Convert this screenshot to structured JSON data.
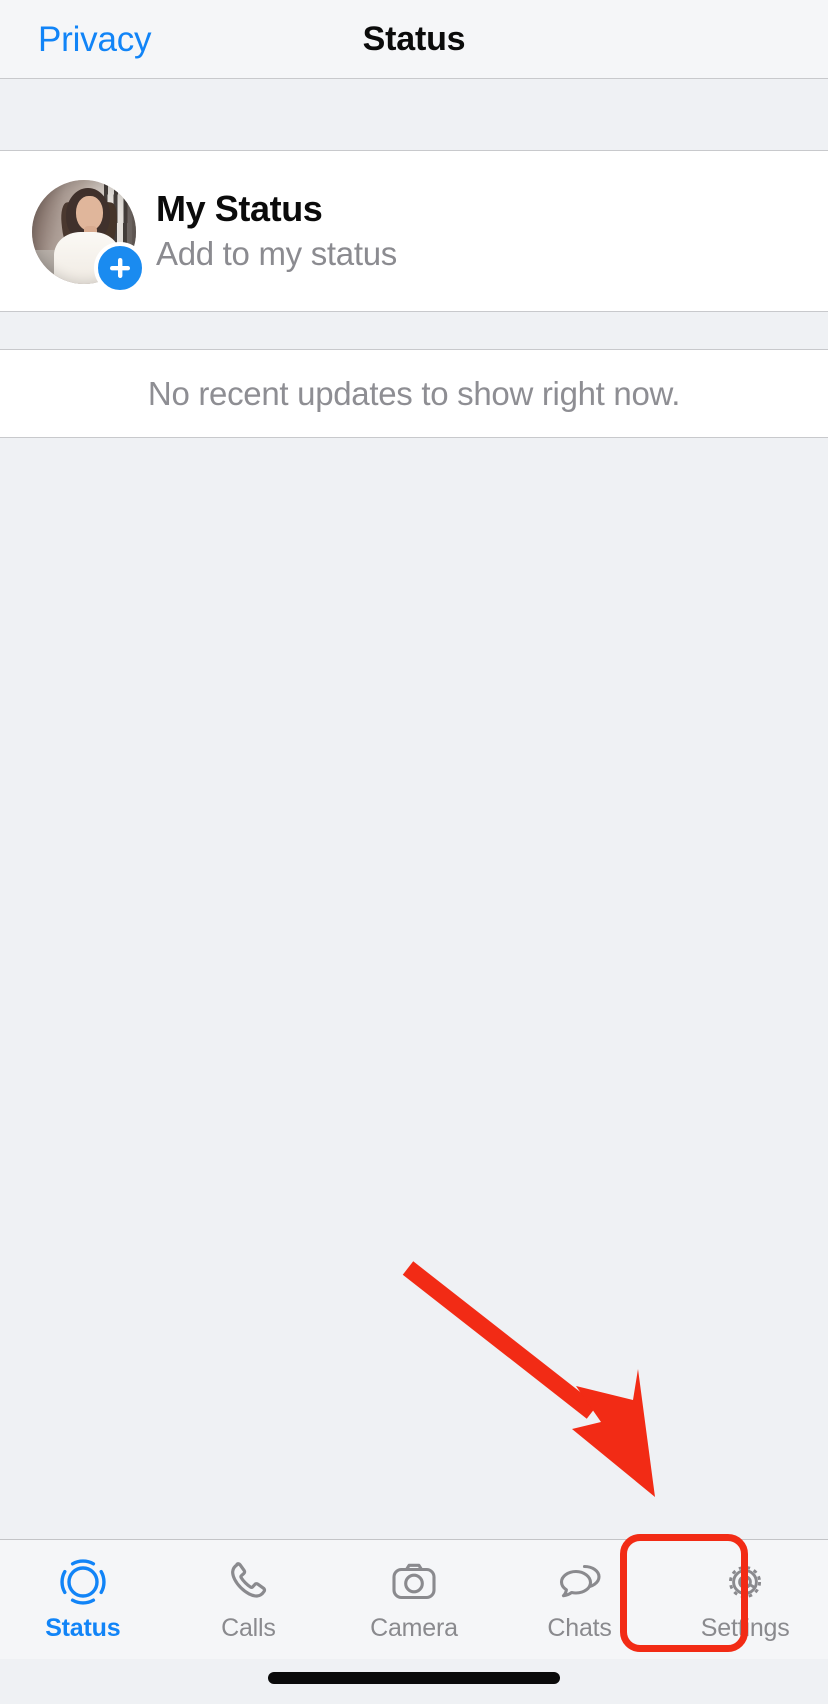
{
  "navbar": {
    "back_label": "Privacy",
    "title": "Status",
    "accent_color": "#1184f7"
  },
  "my_status": {
    "title": "My Status",
    "subtitle": "Add to my status",
    "avatar_name": "profile-photo",
    "add_badge_icon": "plus-icon",
    "camera_button_icon": "camera-icon",
    "edit_button_icon": "pencil-icon",
    "button_bg_color": "#e7e9f8",
    "icon_color": "#1a7df0"
  },
  "empty_state": {
    "message": "No recent updates to show right now."
  },
  "annotation": {
    "arrow_color": "#f22b15",
    "highlight_color": "#f22b15",
    "highlight_target": "Settings"
  },
  "tabbar": {
    "items": [
      {
        "label": "Status",
        "icon": "status-rings-icon",
        "active": true
      },
      {
        "label": "Calls",
        "icon": "phone-icon",
        "active": false
      },
      {
        "label": "Camera",
        "icon": "camera-outline-icon",
        "active": false
      },
      {
        "label": "Chats",
        "icon": "chat-bubbles-icon",
        "active": false
      },
      {
        "label": "Settings",
        "icon": "gear-icon",
        "active": false
      }
    ]
  }
}
